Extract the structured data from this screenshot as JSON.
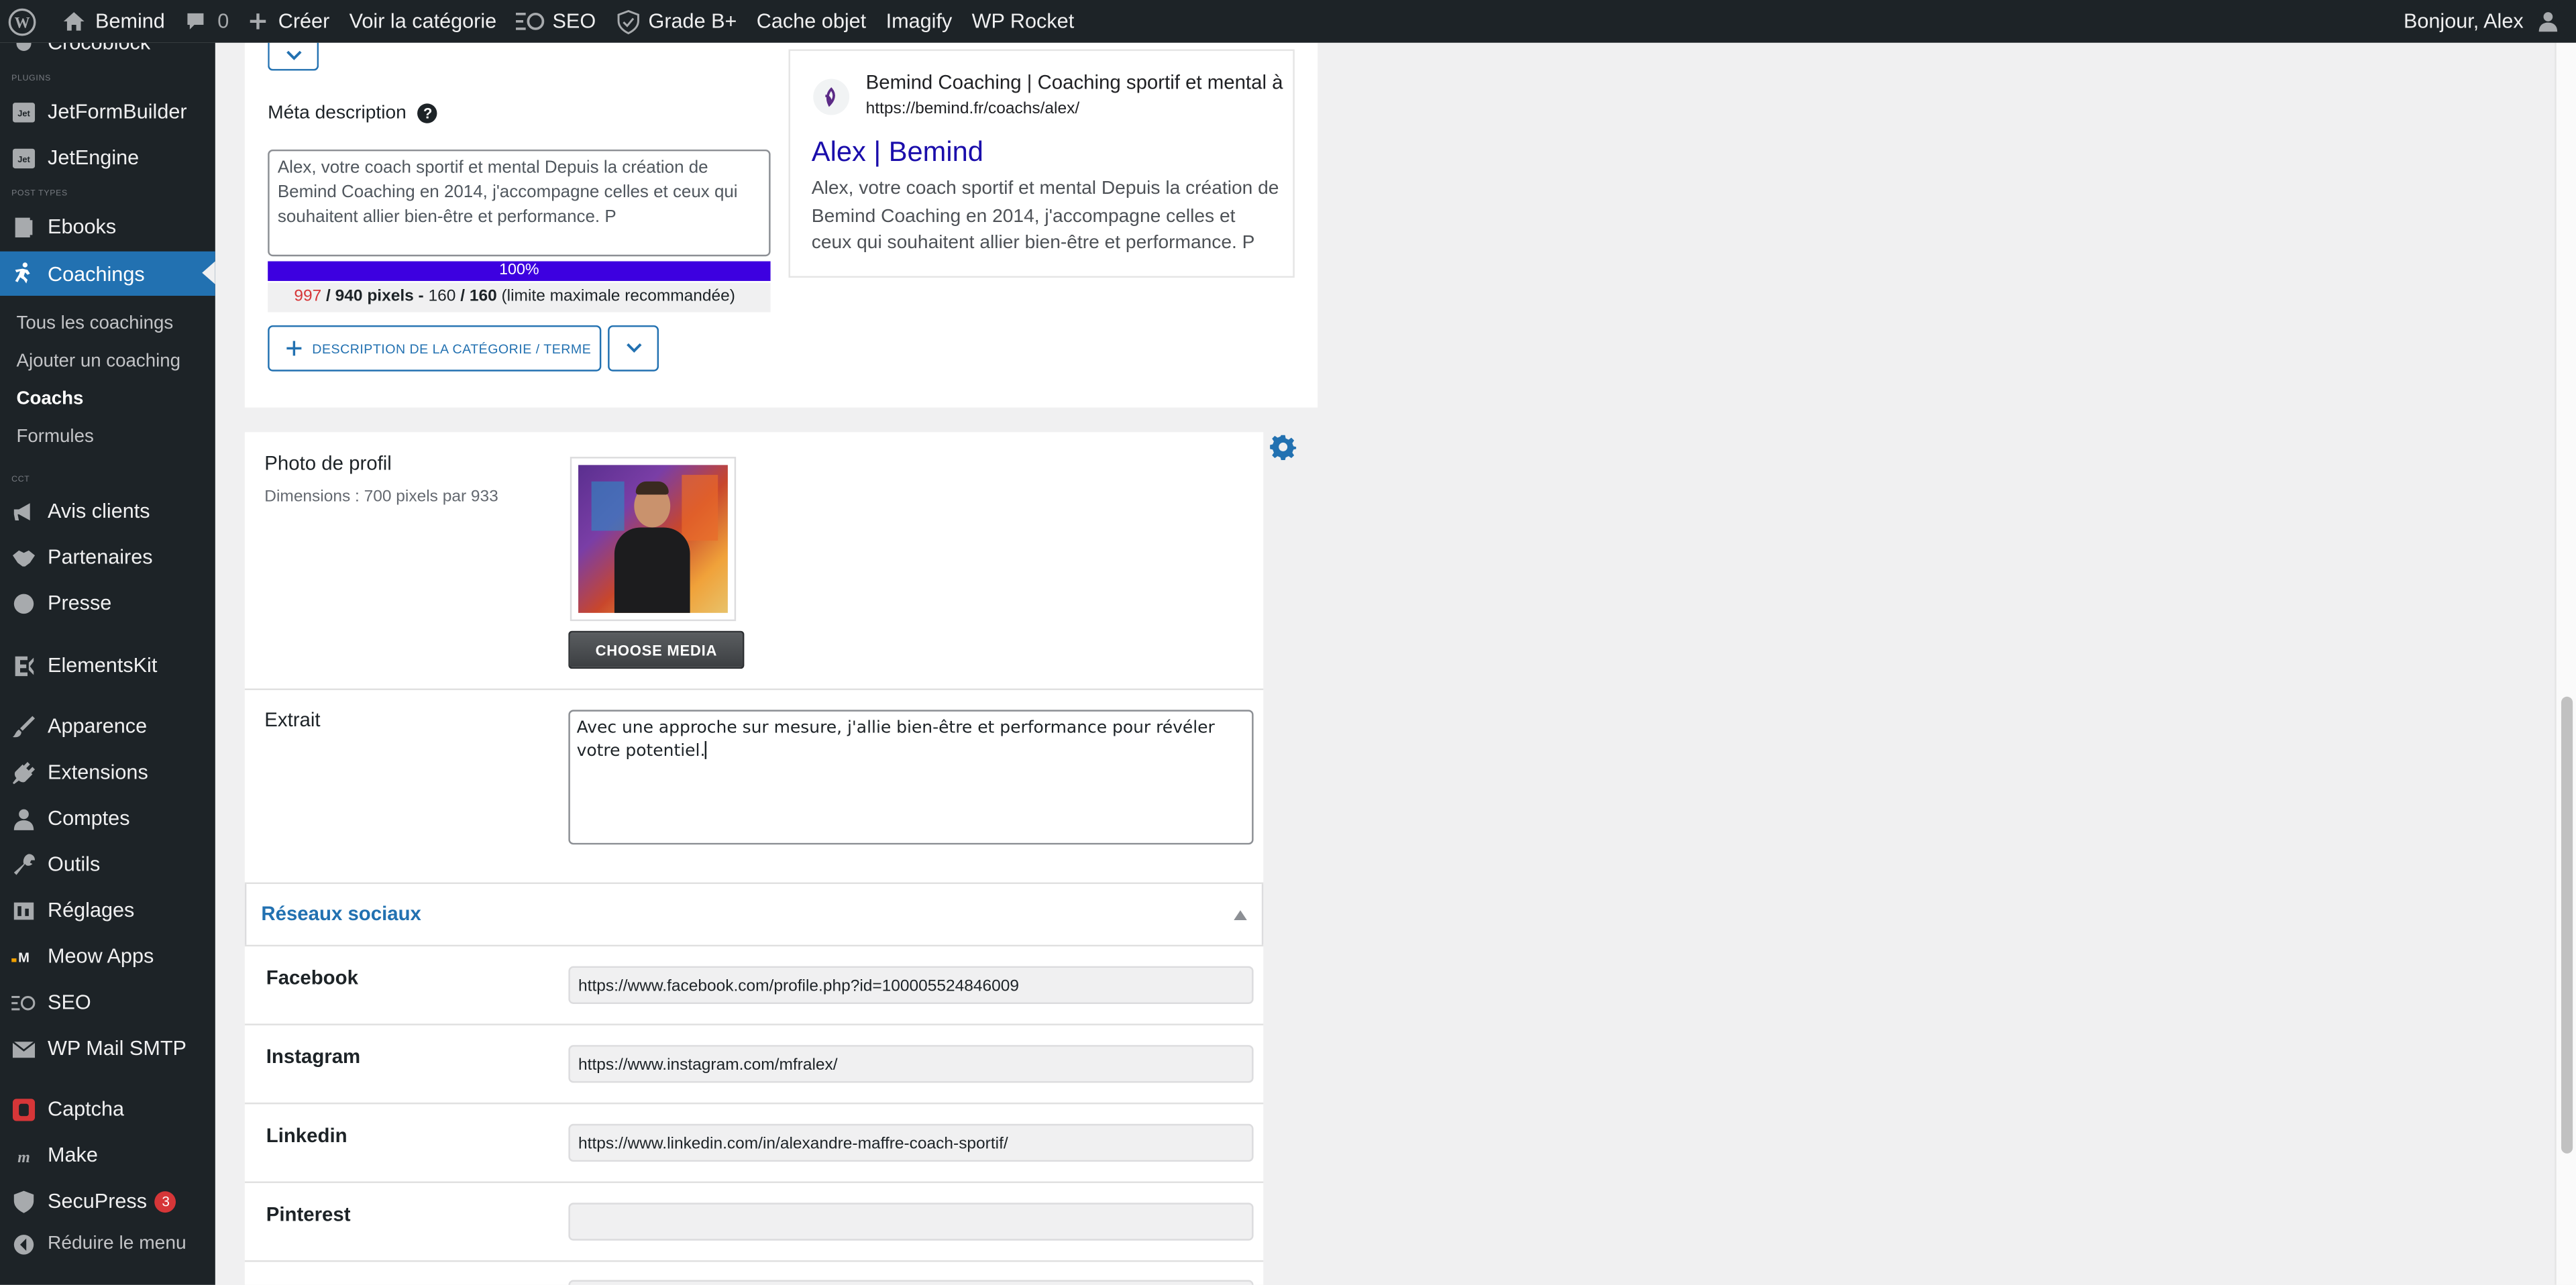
{
  "adminbar": {
    "site_name": "Bemind",
    "comments_count": "0",
    "new_label": "Créer",
    "view_category": "Voir la catégorie",
    "seo": "SEO",
    "grade": "Grade B+",
    "cache": "Cache objet",
    "imagify": "Imagify",
    "wp_rocket": "WP Rocket",
    "greeting": "Bonjour, Alex"
  },
  "sidebar": {
    "cropped_item": "Crocoblock",
    "sep_plugins": "PLUGINS",
    "jetformbuilder": "JetFormBuilder",
    "jetengine": "JetEngine",
    "sep_post_types": "POST TYPES",
    "ebooks": "Ebooks",
    "coachings": "Coachings",
    "sub_all": "Tous les coachings",
    "sub_add": "Ajouter un coaching",
    "sub_coachs": "Coachs",
    "sub_formules": "Formules",
    "sep_cct": "CCT",
    "avis": "Avis clients",
    "partenaires": "Partenaires",
    "presse": "Presse",
    "elementskit": "ElementsKit",
    "apparence": "Apparence",
    "extensions": "Extensions",
    "comptes": "Comptes",
    "outils": "Outils",
    "reglages": "Réglages",
    "meow": "Meow Apps",
    "seo": "SEO",
    "wpmail": "WP Mail SMTP",
    "captcha": "Captcha",
    "make": "Make",
    "secupress": "SecuPress",
    "secupress_badge": "3",
    "collapse": "Réduire le menu"
  },
  "seo_box": {
    "meta_label": "Méta description",
    "meta_text": "Alex, votre coach sportif et mental Depuis la création de Bemind Coaching en 2014, j'accompagne celles et ceux qui souhaitent allier bien-être et performance. P",
    "progress_label": "100%",
    "progress_value": 1.0,
    "pixels_used": "997",
    "pixels_max": "/ 940 pixels -",
    "chars_used": "160",
    "chars_max": "/ 160",
    "limit_note": "(limite maximale recommandée)",
    "cat_button": "DESCRIPTION DE LA CATÉGORIE / TERME",
    "preview_site": "Bemind Coaching | Coaching sportif et mental à",
    "preview_url": "https://bemind.fr/coachs/alex/",
    "preview_title": "Alex | Bemind",
    "preview_desc": "Alex, votre coach sportif et mental Depuis la création de Bemind Coaching en 2014, j'accompagne celles et ceux qui souhaitent allier bien-être et performance. P"
  },
  "profile": {
    "photo_label": "Photo de profil",
    "photo_dims": "Dimensions : 700 pixels par 933",
    "choose_media": "CHOOSE MEDIA",
    "excerpt_label": "Extrait",
    "excerpt_text": "Avec une approche sur mesure, j'allie bien-être et performance pour révéler votre potentiel."
  },
  "social": {
    "title": "Réseaux sociaux",
    "facebook_label": "Facebook",
    "facebook_value": "https://www.facebook.com/profile.php?id=100005524846009",
    "instagram_label": "Instagram",
    "instagram_value": "https://www.instagram.com/mfralex/",
    "linkedin_label": "Linkedin",
    "linkedin_value": "https://www.linkedin.com/in/alexandre-maffre-coach-sportif/",
    "pinterest_label": "Pinterest",
    "pinterest_value": ""
  },
  "colors": {
    "accent": "#2271b1",
    "progress": "#3d00e0",
    "over_limit": "#d63638",
    "sidebar_bg": "#1d2327"
  }
}
